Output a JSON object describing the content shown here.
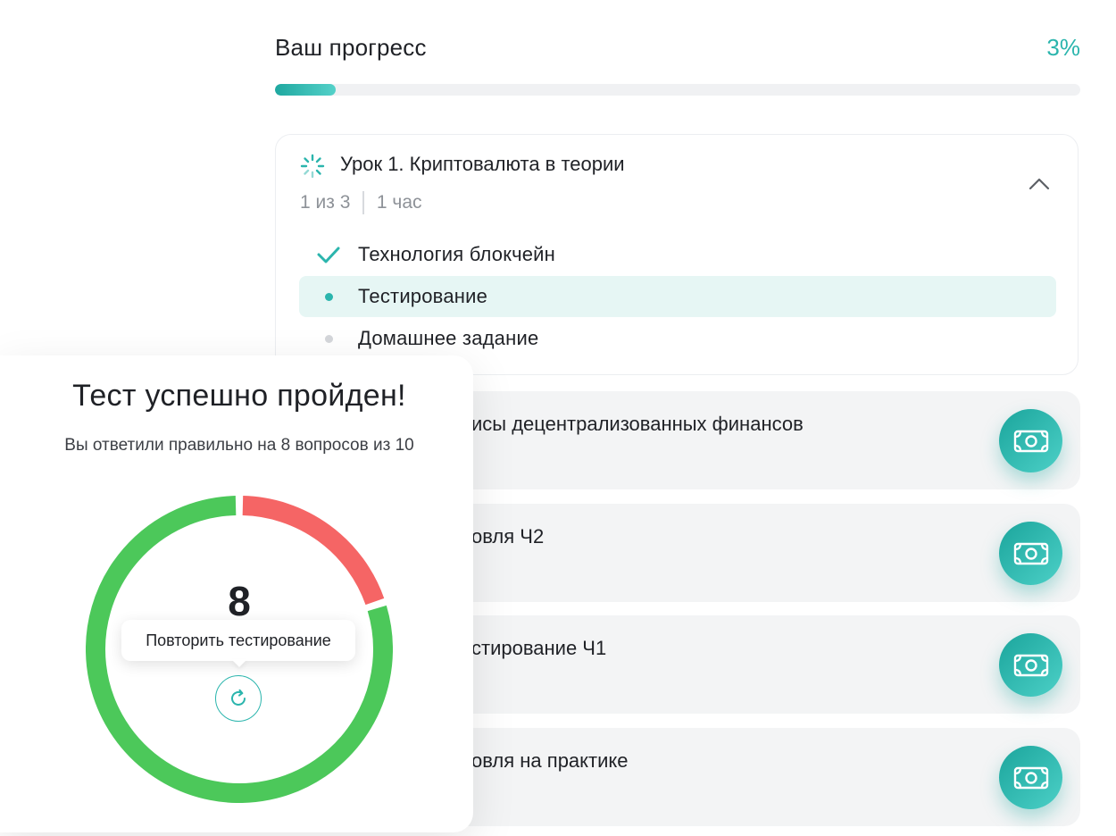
{
  "progress": {
    "title": "Ваш прогресс",
    "percent_label": "3%",
    "fill_fraction": 0.075,
    "accent_color": "#2bb5ad"
  },
  "lesson": {
    "title": "Урок 1. Криптовалюта в теории",
    "step_count": "1 из 3",
    "duration": "1 час",
    "expanded": true,
    "steps": [
      {
        "label": "Технология блокчейн",
        "status": "done",
        "icon": "checkmark-icon"
      },
      {
        "label": "Тестирование",
        "status": "current",
        "icon": "dot-icon"
      },
      {
        "label": "Домашнее задание",
        "status": "pending",
        "icon": "dot-icon"
      }
    ]
  },
  "collapsed_lessons": [
    {
      "title": "исы децентрализованных финансов",
      "icon": "money-icon"
    },
    {
      "title": "овля Ч2",
      "icon": "money-icon"
    },
    {
      "title": "стирование Ч1",
      "icon": "money-icon"
    },
    {
      "title": "овля на практике",
      "icon": "money-icon"
    }
  ],
  "result": {
    "title": "Тест успешно пройден!",
    "subtitle": "Вы ответили правильно на 8 вопросов из 10",
    "score": "8",
    "tooltip": "Повторить тестирование",
    "retry_icon": "refresh-icon"
  },
  "chart_data": {
    "type": "pie",
    "categories": [
      "correct",
      "incorrect"
    ],
    "values": [
      8,
      2
    ],
    "colors": [
      "#4cc85a",
      "#f56565"
    ],
    "title": "",
    "donut": true
  }
}
